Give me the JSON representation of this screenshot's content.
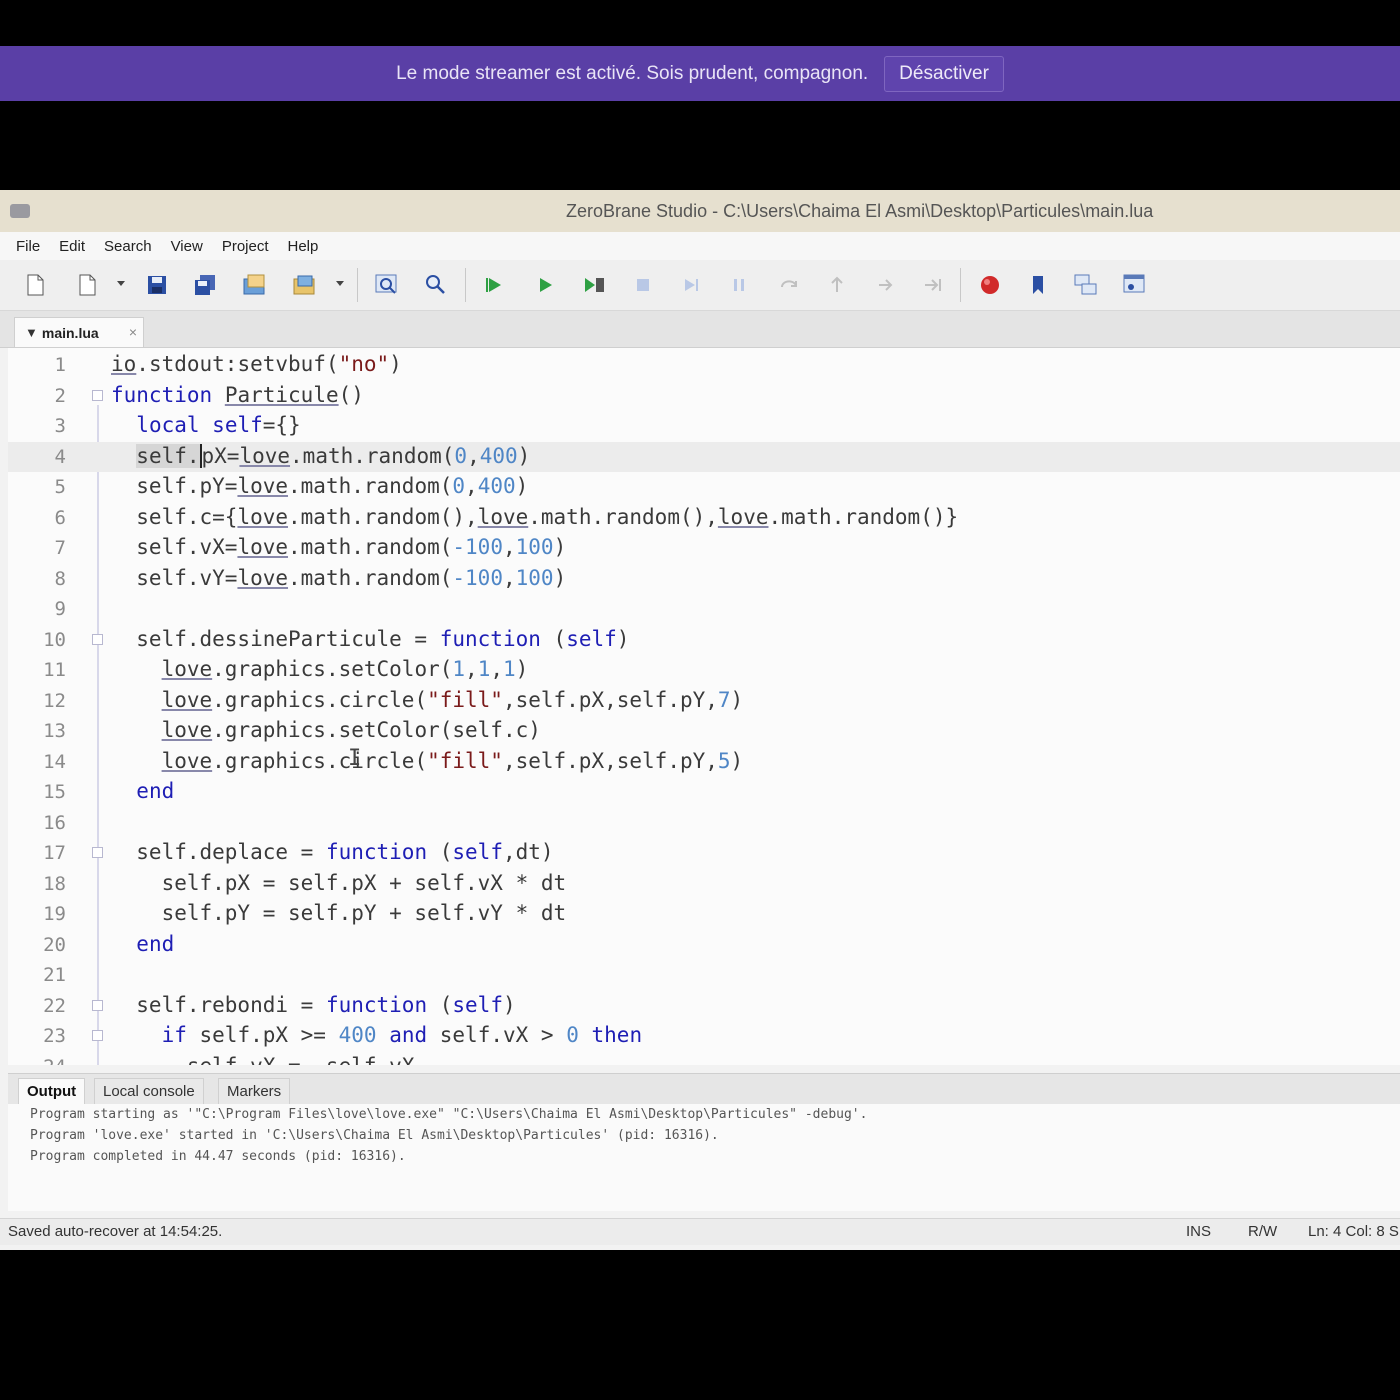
{
  "banner": {
    "message": "Le mode streamer est activé. Sois prudent, compagnon.",
    "button": "Désactiver"
  },
  "window": {
    "title": "ZeroBrane Studio - C:\\Users\\Chaima El Asmi\\Desktop\\Particules\\main.lua"
  },
  "menu": [
    "File",
    "Edit",
    "Search",
    "View",
    "Project",
    "Help"
  ],
  "toolbar": {
    "icons": [
      "new-file-icon",
      "open-file-icon",
      "save-icon",
      "save-all-icon",
      "project-directory-icon",
      "recent-projects-icon",
      "find-icon",
      "find-in-files-icon",
      "run-project-icon",
      "start-debugging-icon",
      "run-to-cursor-icon",
      "stop-icon",
      "step-into-icon",
      "break-icon",
      "step-over-icon",
      "step-out-icon",
      "step-icon",
      "continue-icon",
      "toggle-breakpoint-icon",
      "toggle-bookmark-icon",
      "stack-window-icon",
      "watch-window-icon"
    ]
  },
  "editor": {
    "tab_label": "main.lua",
    "current_line": 4,
    "lines": [
      {
        "n": "1",
        "text": "io.stdout:setvbuf(\"no\")"
      },
      {
        "n": "2",
        "text": "function Particule()"
      },
      {
        "n": "3",
        "text": "  local self={}"
      },
      {
        "n": "4",
        "text": "  self.pX=love.math.random(0,400)"
      },
      {
        "n": "5",
        "text": "  self.pY=love.math.random(0,400)"
      },
      {
        "n": "6",
        "text": "  self.c={love.math.random(),love.math.random(),love.math.random()}"
      },
      {
        "n": "7",
        "text": "  self.vX=love.math.random(-100,100)"
      },
      {
        "n": "8",
        "text": "  self.vY=love.math.random(-100,100)"
      },
      {
        "n": "9",
        "text": ""
      },
      {
        "n": "10",
        "text": "  self.dessineParticule = function (self)"
      },
      {
        "n": "11",
        "text": "    love.graphics.setColor(1,1,1)"
      },
      {
        "n": "12",
        "text": "    love.graphics.circle(\"fill\",self.pX,self.pY,7)"
      },
      {
        "n": "13",
        "text": "    love.graphics.setColor(self.c)"
      },
      {
        "n": "14",
        "text": "    love.graphics.circle(\"fill\",self.pX,self.pY,5)"
      },
      {
        "n": "15",
        "text": "  end"
      },
      {
        "n": "16",
        "text": ""
      },
      {
        "n": "17",
        "text": "  self.deplace = function (self,dt)"
      },
      {
        "n": "18",
        "text": "    self.pX = self.pX + self.vX * dt"
      },
      {
        "n": "19",
        "text": "    self.pY = self.pY + self.vY * dt"
      },
      {
        "n": "20",
        "text": "  end"
      },
      {
        "n": "21",
        "text": ""
      },
      {
        "n": "22",
        "text": "  self.rebondi = function (self)"
      },
      {
        "n": "23",
        "text": "    if self.pX >= 400 and self.vX > 0 then"
      },
      {
        "n": "24",
        "text": "      self.vX = -self.vX"
      }
    ]
  },
  "panel": {
    "tabs": [
      "Output",
      "Local console",
      "Markers"
    ],
    "output": [
      "Program starting as '\"C:\\Program Files\\love\\love.exe\" \"C:\\Users\\Chaima El Asmi\\Desktop\\Particules\" -debug'.",
      "Program 'love.exe' started in 'C:\\Users\\Chaima El Asmi\\Desktop\\Particules' (pid: 16316).",
      "Program completed in 44.47 seconds (pid: 16316)."
    ]
  },
  "status": {
    "message": "Saved auto-recover at 14:54:25.",
    "mode": "INS",
    "access": "R/W",
    "position": "Ln: 4 Col: 8 S"
  },
  "colors": {
    "banner": "#5a3fa6",
    "keyword": "#1e1eb4",
    "string": "#7a1a1a",
    "number": "#4f86c6"
  }
}
